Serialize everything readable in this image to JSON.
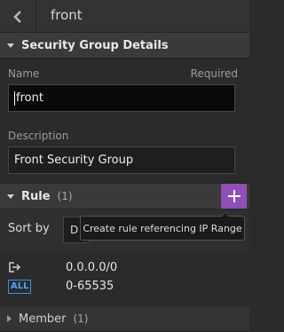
{
  "header": {
    "title": "front"
  },
  "details": {
    "section_title": "Security Group Details",
    "name_label": "Name",
    "required_label": "Required",
    "name_value": "front",
    "description_label": "Description",
    "description_value": "Front Security Group"
  },
  "rule": {
    "section_title": "Rule",
    "count": "(1)",
    "add_icon": "plus-icon",
    "sort_label": "Sort by",
    "sort_value": "D",
    "tooltip": "Create rule referencing IP Range",
    "items": [
      {
        "direction_icon": "outbound-icon",
        "protocol": "ALL",
        "ip_range": "0.0.0.0/0",
        "port_range": "0-65535"
      }
    ]
  },
  "member": {
    "section_title": "Member",
    "count": "(1)"
  },
  "colors": {
    "accent": "#8f4fb5",
    "protocol_badge": "#4da3ff",
    "background": "#2b2b2b"
  }
}
